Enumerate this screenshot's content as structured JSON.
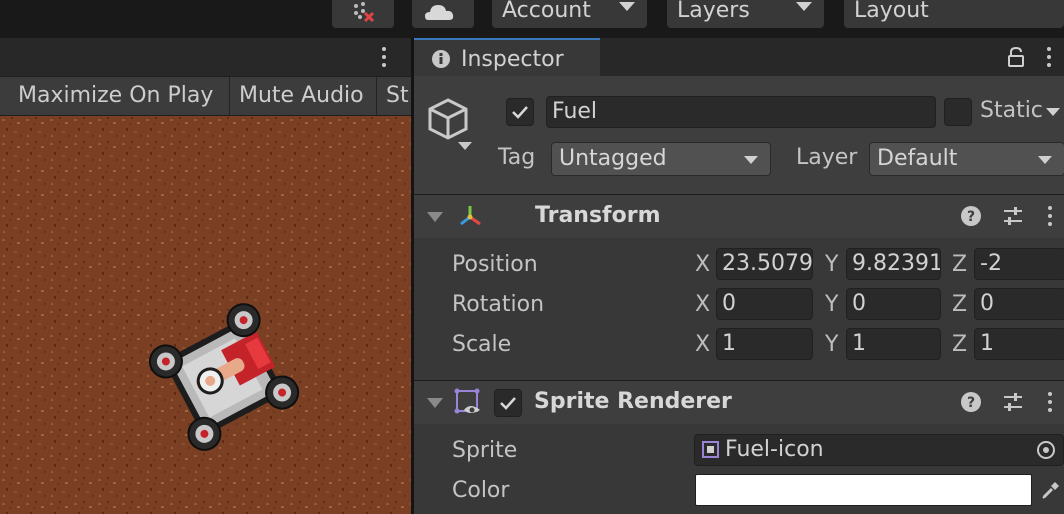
{
  "toolbar": {
    "account_label": "Account",
    "layers_label": "Layers",
    "layout_label": "Layout"
  },
  "game_view": {
    "options": [
      "Maximize On Play",
      "Mute Audio",
      "St"
    ]
  },
  "inspector": {
    "tab_title": "Inspector",
    "object": {
      "active": true,
      "name": "Fuel",
      "static_label": "Static",
      "tag_label": "Tag",
      "tag_value": "Untagged",
      "layer_label": "Layer",
      "layer_value": "Default"
    },
    "transform": {
      "title": "Transform",
      "rows": [
        {
          "label": "Position",
          "x": "23.5079",
          "y": "9.82391",
          "z": "-2"
        },
        {
          "label": "Rotation",
          "x": "0",
          "y": "0",
          "z": "0"
        },
        {
          "label": "Scale",
          "x": "1",
          "y": "1",
          "z": "1"
        }
      ]
    },
    "sprite_renderer": {
      "title": "Sprite Renderer",
      "enabled": true,
      "sprite_label": "Sprite",
      "sprite_value": "Fuel-icon",
      "color_label": "Color",
      "color_value": "#FFFFFF"
    }
  },
  "axis_labels": {
    "x": "X",
    "y": "Y",
    "z": "Z"
  },
  "colors": {
    "accent": "#3a79bb",
    "panel": "#383838",
    "field": "#2a2a2a",
    "ground": "#7a3f24"
  }
}
